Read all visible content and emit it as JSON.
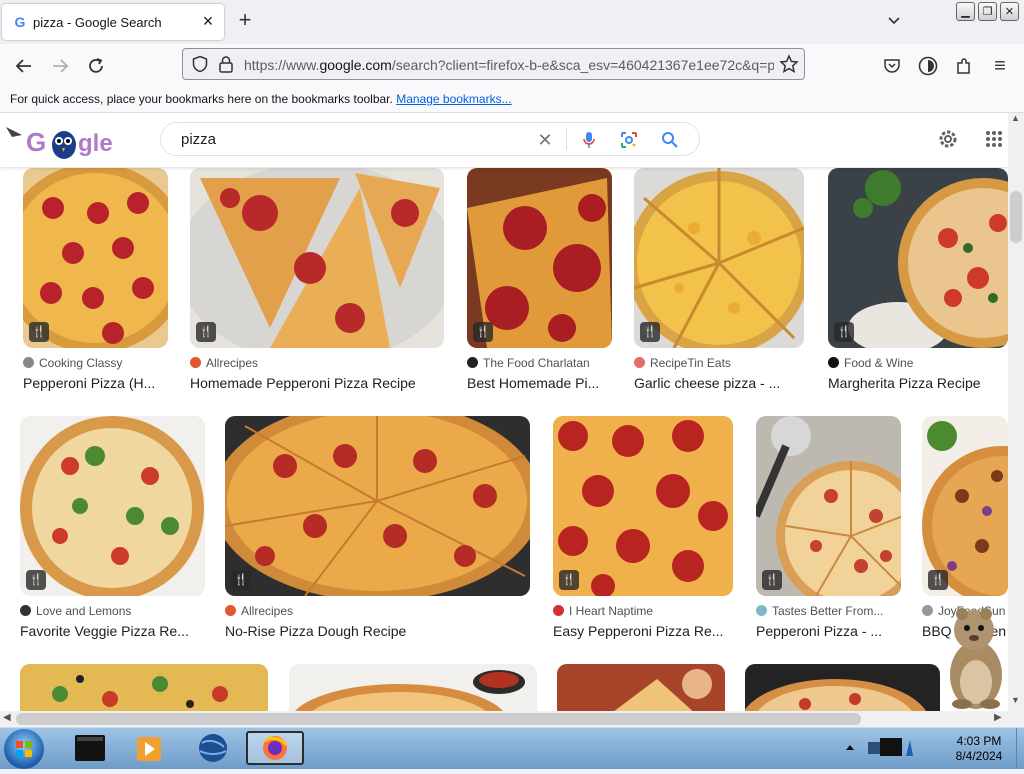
{
  "browser": {
    "tab_title": "pizza - Google Search",
    "url_prefix": "https://www.",
    "url_domain": "google.com",
    "url_rest": "/search?client=firefox-b-e&sca_esv=460421367e1ee72c&q=p",
    "bookmarks_text": "For quick access, place your bookmarks here on the bookmarks toolbar.",
    "bookmarks_link": "Manage bookmarks..."
  },
  "search": {
    "query": "pizza"
  },
  "results_row1": [
    {
      "source": "Cooking Classy",
      "title": "Pepperoni Pizza (H...",
      "icon_color": "#888888"
    },
    {
      "source": "Allrecipes",
      "title": "Homemade Pepperoni Pizza Recipe",
      "icon_color": "#e2572b"
    },
    {
      "source": "The Food Charlatan",
      "title": "Best Homemade Pi...",
      "icon_color": "#222222"
    },
    {
      "source": "RecipeTin Eats",
      "title": "Garlic cheese pizza - ...",
      "icon_color": "#e86a6a"
    },
    {
      "source": "Food & Wine",
      "title": "Margherita Pizza Recipe",
      "icon_color": "#111111"
    }
  ],
  "results_row2": [
    {
      "source": "Love and Lemons",
      "title": "Favorite Veggie Pizza Re...",
      "icon_color": "#333333"
    },
    {
      "source": "Allrecipes",
      "title": "No-Rise Pizza Dough Recipe",
      "icon_color": "#e2572b"
    },
    {
      "source": "I Heart Naptime",
      "title": "Easy Pepperoni Pizza Re...",
      "icon_color": "#d33030"
    },
    {
      "source": "Tastes Better From...",
      "title": "Pepperoni Pizza - ...",
      "icon_color": "#7fb8c8"
    },
    {
      "source": "JoyFoodSun",
      "title": "BBQ Chicken",
      "icon_color": "#999999"
    }
  ],
  "taskbar": {
    "time": "4:03 PM",
    "date": "8/4/2024"
  },
  "colors": {
    "accent": "#1a73e8",
    "chrome_bg": "#f0f0f4"
  }
}
